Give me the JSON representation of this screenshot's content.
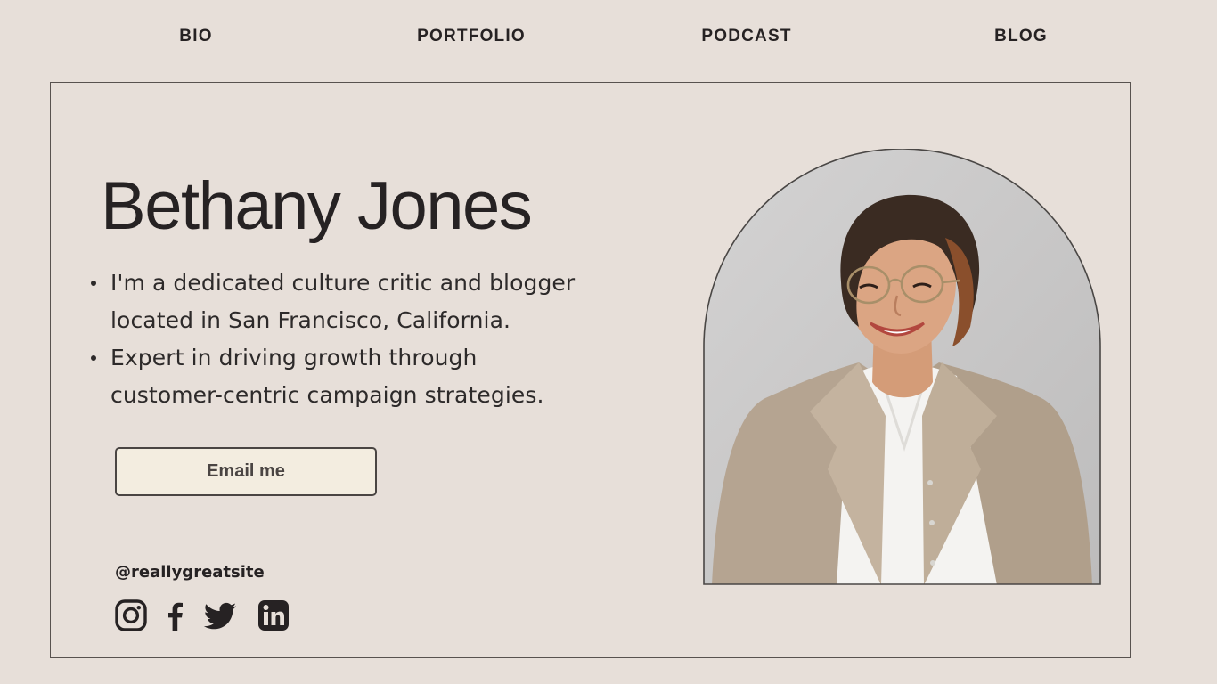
{
  "nav": {
    "items": [
      {
        "label": "BIO"
      },
      {
        "label": "PORTFOLIO"
      },
      {
        "label": "PODCAST"
      },
      {
        "label": "BLOG"
      }
    ]
  },
  "hero": {
    "name": "Bethany Jones",
    "bullets": [
      {
        "line1": "I'm a dedicated culture critic and blogger",
        "line2": "located in San Francisco, California."
      },
      {
        "line1": "Expert in driving growth through",
        "line2": "customer-centric campaign strategies."
      }
    ],
    "email_button": "Email me"
  },
  "social": {
    "handle": "@reallygreatsite",
    "icons": [
      "instagram-icon",
      "facebook-icon",
      "twitter-icon",
      "linkedin-icon"
    ]
  },
  "colors": {
    "background": "#e7dfd9",
    "text": "#262223",
    "button_fill": "#f3ede0",
    "photo_backdrop": "#c9c8c8"
  }
}
